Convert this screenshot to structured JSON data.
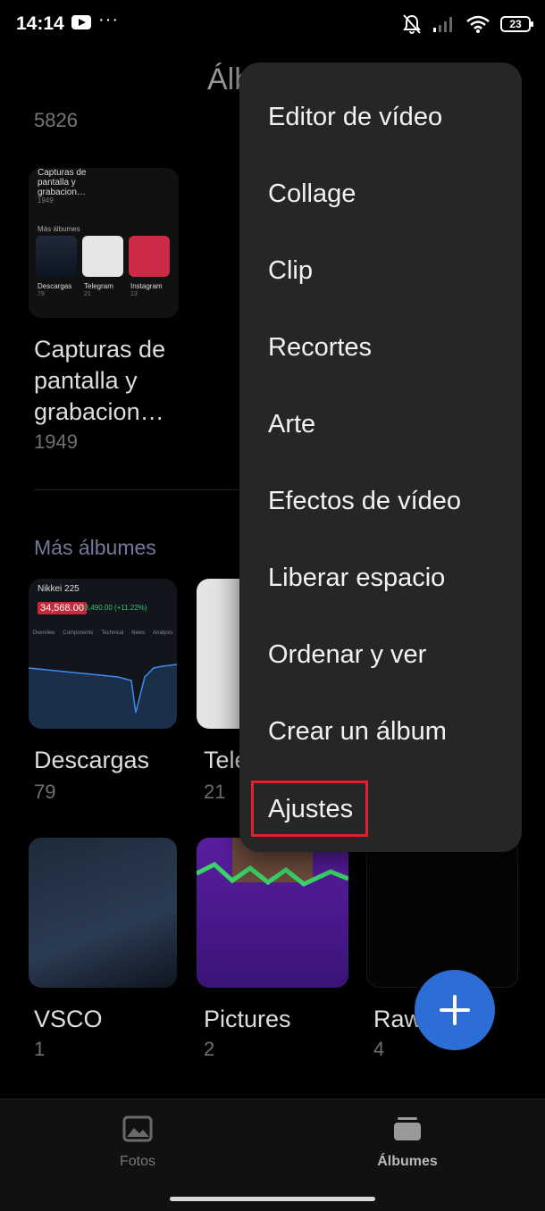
{
  "status_bar": {
    "time": "14:14",
    "more": "···",
    "battery": "23"
  },
  "header": {
    "title": "Álbumes"
  },
  "first_album": {
    "count": "5826"
  },
  "screenshot_album": {
    "thumb_title": "Capturas de pantalla y grabacion…",
    "thumb_count": "1949",
    "thumb_more": "Más álbumes",
    "thumb_tiles": [
      {
        "label": "Descargas",
        "count": "79"
      },
      {
        "label": "Telegram",
        "count": "21"
      },
      {
        "label": "Instagram",
        "count": "13"
      }
    ],
    "name": "Capturas de pantalla y grabacion…",
    "count": "1949"
  },
  "more_albums": {
    "heading": "Más álbumes"
  },
  "albums": [
    {
      "name": "Descargas",
      "count": "79"
    },
    {
      "name": "Tele",
      "count": "21"
    },
    {
      "name": "VSCO",
      "count": "1"
    },
    {
      "name": "Pictures",
      "count": "2"
    },
    {
      "name": "Raw",
      "count": "4"
    }
  ],
  "stock_thumb": {
    "ticker": "Nikkei 225",
    "price": "34,568.00",
    "change": "+3,490.00 (+11.22%)",
    "tabs": [
      "Overview",
      "Components",
      "Technical",
      "News",
      "Analysis"
    ]
  },
  "menu": {
    "items": [
      "Editor de vídeo",
      "Collage",
      "Clip",
      "Recortes",
      "Arte",
      "Efectos de vídeo",
      "Liberar espacio",
      "Ordenar y ver",
      "Crear un álbum",
      "Ajustes"
    ],
    "highlighted": "Ajustes",
    "highlight_color": "#e0202a"
  },
  "fab": {
    "icon": "plus-icon",
    "color": "#2d6ed6"
  },
  "bottom_nav": {
    "items": [
      {
        "label": "Fotos",
        "icon": "photo-icon",
        "active": false
      },
      {
        "label": "Álbumes",
        "icon": "albums-icon",
        "active": true
      }
    ]
  }
}
